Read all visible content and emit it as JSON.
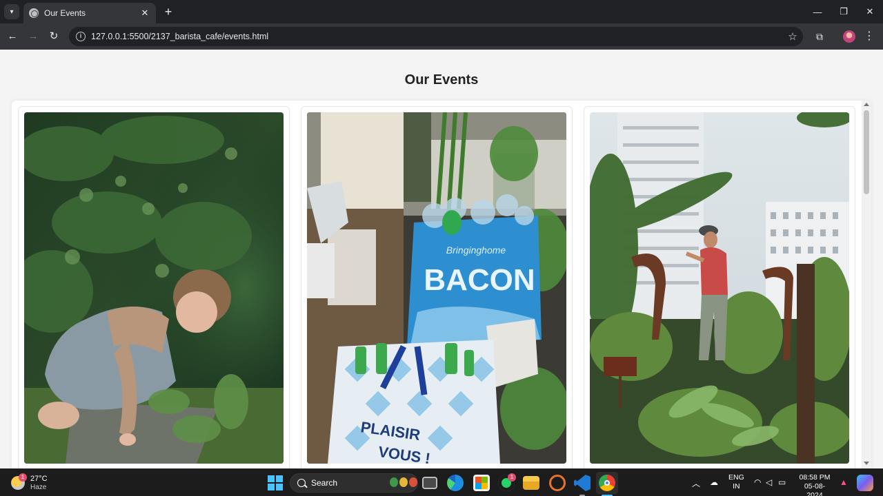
{
  "browser": {
    "tab_title": "Our Events",
    "url": "127.0.0.1:5500/2137_barista_cafe/events.html",
    "tab_close": "✕",
    "new_tab": "+",
    "window_controls": {
      "minimize": "—",
      "restore": "❐",
      "close": "✕"
    },
    "nav": {
      "back": "←",
      "forward": "→",
      "reload": "↻"
    },
    "star": "☆",
    "extensions": "⧉",
    "menu": "⋮",
    "info": "i"
  },
  "page": {
    "title": "Our Events",
    "cards": [
      {
        "alt": "Child playing in a garden",
        "icon": "image-garden-child"
      },
      {
        "alt": "Recycling bags with plastic bottles",
        "icon": "image-recycling-bags"
      },
      {
        "alt": "Person gardening in an urban plot",
        "icon": "image-urban-garden"
      }
    ]
  },
  "taskbar": {
    "weather": {
      "temp": "27°C",
      "condition": "Haze",
      "badge": "1"
    },
    "search_label": "Search",
    "whatsapp_badge": "1",
    "language": {
      "line1": "ENG",
      "line2": "IN"
    },
    "clock": {
      "time": "08:58 PM",
      "date": "05-08-2024"
    }
  }
}
